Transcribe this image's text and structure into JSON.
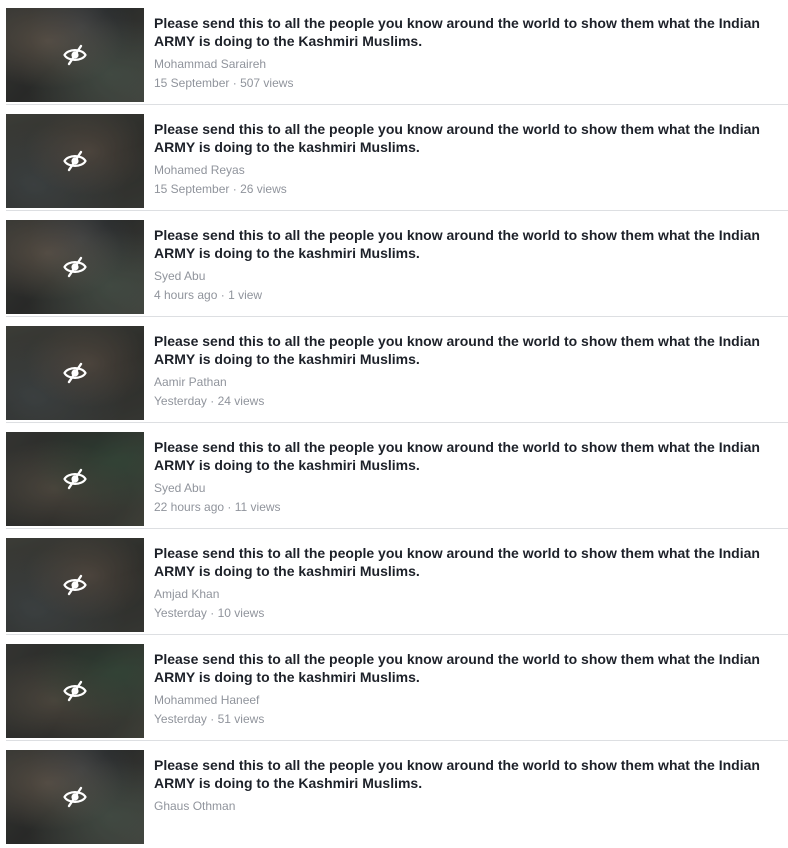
{
  "icons": {
    "hidden_content": "eye-slash-icon"
  },
  "colors": {
    "title_text": "#1d2129",
    "secondary_text": "#90949c",
    "divider": "#dddfe2"
  },
  "results": [
    {
      "title": "Please send this to all the people you know around the world to show them what the Indian ARMY is doing to the Kashmiri Muslims.",
      "author": "Mohammad Saraireh",
      "date": "15 September",
      "separator": "·",
      "views": "507 views"
    },
    {
      "title": "Please send this to all the people you know around the world to show them what the Indian ARMY is doing to the kashmiri Muslims.",
      "author": "Mohamed Reyas",
      "date": "15 September",
      "separator": "·",
      "views": "26 views"
    },
    {
      "title": "Please send this to all the people you know around the world to show them what the Indian ARMY is doing to the kashmiri Muslims.",
      "author": "Syed Abu",
      "date": "4 hours ago",
      "separator": "·",
      "views": "1 view"
    },
    {
      "title": "Please send this to all the people you know around the world to show them what the Indian ARMY is doing to the kashmiri Muslims.",
      "author": "Aamir Pathan",
      "date": "Yesterday",
      "separator": "·",
      "views": "24 views"
    },
    {
      "title": "Please send this to all the people you know around the world to show them what the Indian ARMY is doing to the kashmiri Muslims.",
      "author": "Syed Abu",
      "date": "22 hours ago",
      "separator": "·",
      "views": "11 views"
    },
    {
      "title": "Please send this to all the people you know around the world to show them what the Indian ARMY is doing to the kashmiri Muslims.",
      "author": "Amjad Khan",
      "date": "Yesterday",
      "separator": "·",
      "views": "10 views"
    },
    {
      "title": "Please send this to all the people you know around the world to show them what the Indian ARMY is doing to the kashmiri Muslims.",
      "author": "Mohammed Haneef",
      "date": "Yesterday",
      "separator": "·",
      "views": "51 views"
    },
    {
      "title": "Please send this to all the people you know around the world to show them what the Indian ARMY is doing to the Kashmiri Muslims.",
      "author": "Ghaus Othman"
    }
  ]
}
